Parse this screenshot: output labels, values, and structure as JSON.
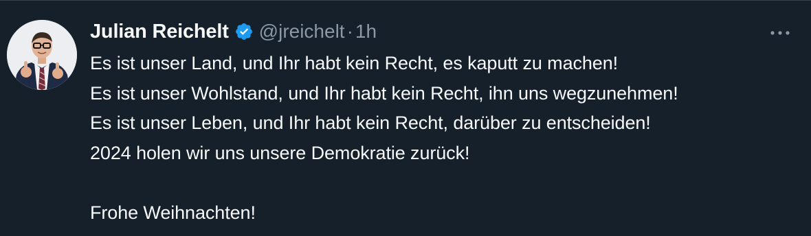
{
  "tweet": {
    "author_name": "Julian Reichelt",
    "verified": true,
    "handle": "@jreichelt",
    "separator": "·",
    "time": "1h",
    "lines": [
      "Es ist unser Land, und Ihr habt kein Recht, es kaputt zu machen!",
      "Es ist unser Wohlstand, und Ihr habt kein Recht, ihn uns wegzunehmen!",
      "Es ist unser Leben, und Ihr habt kein Recht, darüber zu entscheiden!",
      "2024 holen wir uns unsere Demokratie zurück!",
      "",
      "Frohe Weihnachten!"
    ],
    "icons": {
      "verified": "verified-badge-icon",
      "more": "more-options-icon"
    }
  },
  "colors": {
    "background": "#15202b",
    "text_primary": "#f7f9f9",
    "text_secondary": "#8b98a5",
    "verified_blue": "#1d9bf0",
    "divider": "#38444d"
  }
}
